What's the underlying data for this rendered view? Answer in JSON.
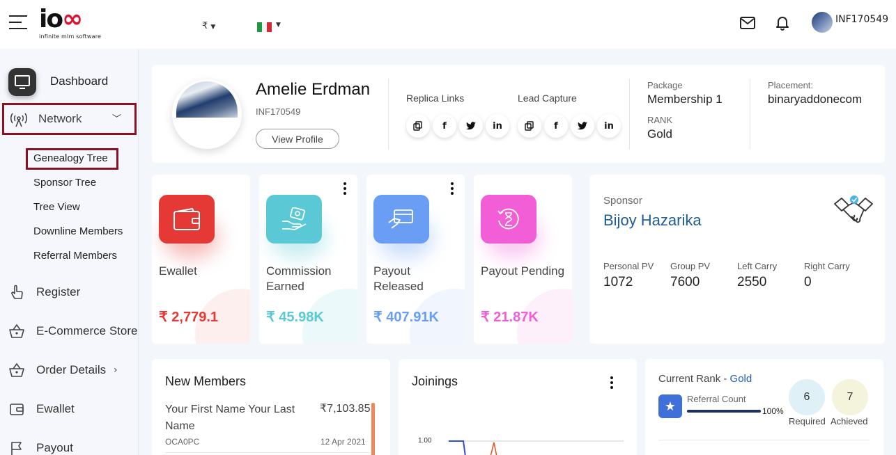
{
  "header": {
    "logo_text": "ioss",
    "logo_tagline": "infinite mlm software",
    "currency_symbol": "₹",
    "user_id": "INF170549"
  },
  "sidebar": {
    "dashboard": "Dashboard",
    "network": "Network",
    "network_sub": [
      "Genealogy Tree",
      "Sponsor Tree",
      "Tree View",
      "Downline Members",
      "Referral Members"
    ],
    "register": "Register",
    "ecommerce": "E-Commerce Store",
    "order_details": "Order Details",
    "ewallet": "Ewallet",
    "payout": "Payout"
  },
  "profile": {
    "name": "Amelie Erdman",
    "id": "INF170549",
    "view_profile": "View Profile",
    "replica_links": "Replica Links",
    "lead_capture": "Lead Capture",
    "package_label": "Package",
    "package_value": "Membership 1",
    "rank_label": "RANK",
    "rank_value": "Gold",
    "placement_label": "Placement:",
    "placement_value": "binaryaddonecom"
  },
  "stats": [
    {
      "title": "Ewallet",
      "amount": "₹ 2,779.1",
      "color": "#e53935"
    },
    {
      "title": "Commission Earned",
      "amount": "₹ 45.98K",
      "color": "#5bc8d6"
    },
    {
      "title": "Payout Released",
      "amount": "₹ 407.91K",
      "color": "#6a9ef5"
    },
    {
      "title": "Payout Pending",
      "amount": "₹ 21.87K",
      "color": "#f25ed6"
    }
  ],
  "sponsor": {
    "label": "Sponsor",
    "name": "Bijoy Hazarika",
    "stats": [
      {
        "label": "Personal PV",
        "value": "1072"
      },
      {
        "label": "Group PV",
        "value": "7600"
      },
      {
        "label": "Left Carry",
        "value": "2550"
      },
      {
        "label": "Right Carry",
        "value": "0"
      }
    ]
  },
  "new_members": {
    "title": "New Members",
    "item_name": "Your First Name Your Last Name",
    "item_amount": "₹7,103.85",
    "item_code": "OCA0PC",
    "item_date": "12 Apr 2021"
  },
  "joinings": {
    "title": "Joinings",
    "y_tick": "1.00"
  },
  "current_rank": {
    "label": "Current Rank - ",
    "rank": "Gold",
    "referral_label": "Referral Count",
    "progress_pct": 100,
    "progress_text": "100%",
    "required_value": "6",
    "required_label": "Required",
    "achieved_value": "7",
    "achieved_label": "Achieved"
  }
}
